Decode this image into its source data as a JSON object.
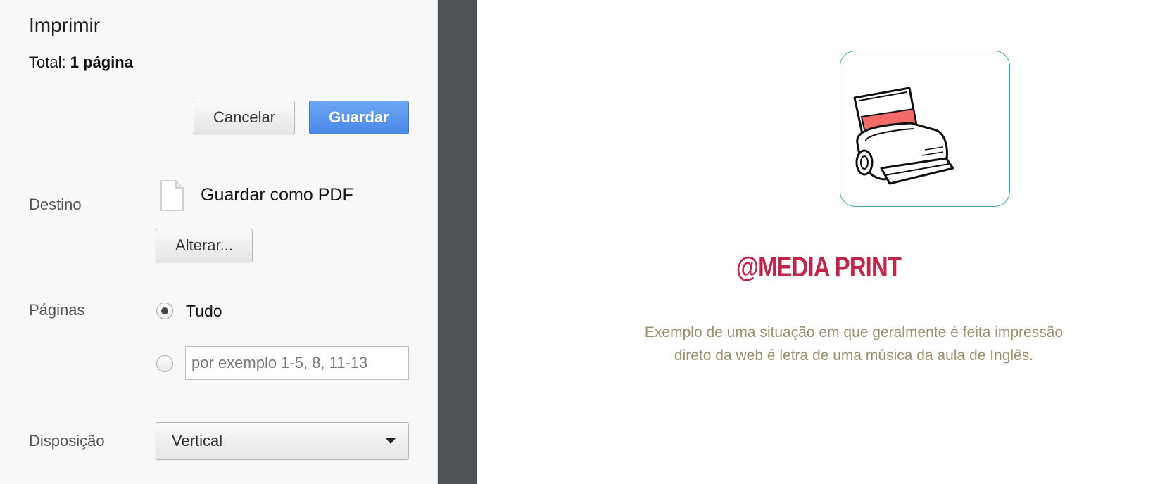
{
  "print_panel": {
    "title": "Imprimir",
    "total_label": "Total:",
    "total_value": "1 página",
    "cancel_label": "Cancelar",
    "save_label": "Guardar",
    "destination": {
      "label": "Destino",
      "value": "Guardar como PDF",
      "icon": "document-icon",
      "change_label": "Alterar..."
    },
    "pages": {
      "label": "Páginas",
      "all_label": "Tudo",
      "selected": "all",
      "custom_placeholder": "por exemplo 1-5, 8, 11-13"
    },
    "layout": {
      "label": "Disposição",
      "selected": "Vertical"
    }
  },
  "preview": {
    "heading": "@MEDIA PRINT",
    "description": "Exemplo de uma situação em que geralmente é feita impressão direto da web é letra de uma música da aula de Inglês.",
    "image_icon": "printer-icon"
  },
  "colors": {
    "primary_button": "#4a89ea",
    "heading": "#c0264a",
    "description": "#9c8f6e",
    "card_border": "#3aa6a6",
    "paper_fill": "#f26a6a",
    "gutter": "#4f5356"
  }
}
